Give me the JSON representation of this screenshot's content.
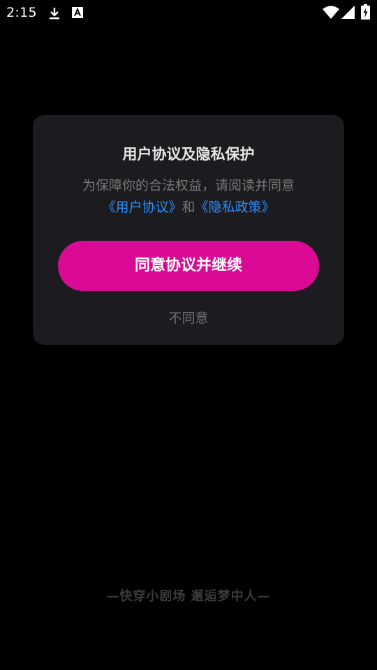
{
  "status_bar": {
    "time": "2:15",
    "icons": [
      "download-icon",
      "a-notification-icon",
      "wifi-icon",
      "cellular-signal-icon",
      "battery-charging-icon"
    ]
  },
  "dialog": {
    "title": "用户协议及隐私保护",
    "description_line1": "为保障你的合法权益，请阅读并同意",
    "user_agreement_link": "《用户协议》",
    "conjunction": "和",
    "privacy_policy_link": "《隐私政策》",
    "agree_button": "同意协议并继续",
    "disagree_button": "不同意"
  },
  "footer": {
    "slogan": "—快穿小剧场 邂逅梦中人—"
  },
  "colors": {
    "background": "#000000",
    "dialog_background": "#1c1c20",
    "accent": "#db0a95",
    "link": "#2f8df5"
  }
}
